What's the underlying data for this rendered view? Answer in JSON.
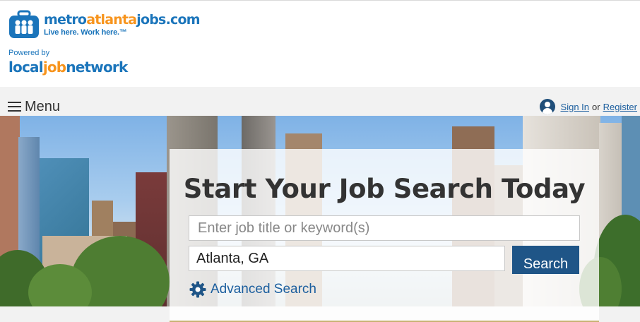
{
  "brand": {
    "logo_metro": "metro",
    "logo_atlanta": "atlanta",
    "logo_jobs": "jobs",
    "logo_dotcom": ".com",
    "tagline": "Live here. Work here.™",
    "powered_by": "Powered by",
    "network_local": "local",
    "network_job": "job",
    "network_network": "network",
    "colors": {
      "blue": "#1b75bb",
      "orange": "#f7941d"
    }
  },
  "nav": {
    "menu_label": "Menu",
    "sign_in": "Sign In",
    "or_text": "or",
    "register": "Register"
  },
  "search": {
    "heading": "Start Your Job Search Today",
    "keyword_placeholder": "Enter job title or keyword(s)",
    "keyword_value": "",
    "location_value": "Atlanta, GA",
    "search_button": "Search",
    "advanced_link": "Advanced Search",
    "button_color": "#1f5587"
  },
  "icons": {
    "logo": "briefcase-people-icon",
    "menu": "hamburger-icon",
    "user": "user-icon",
    "advanced": "gear-icon"
  }
}
